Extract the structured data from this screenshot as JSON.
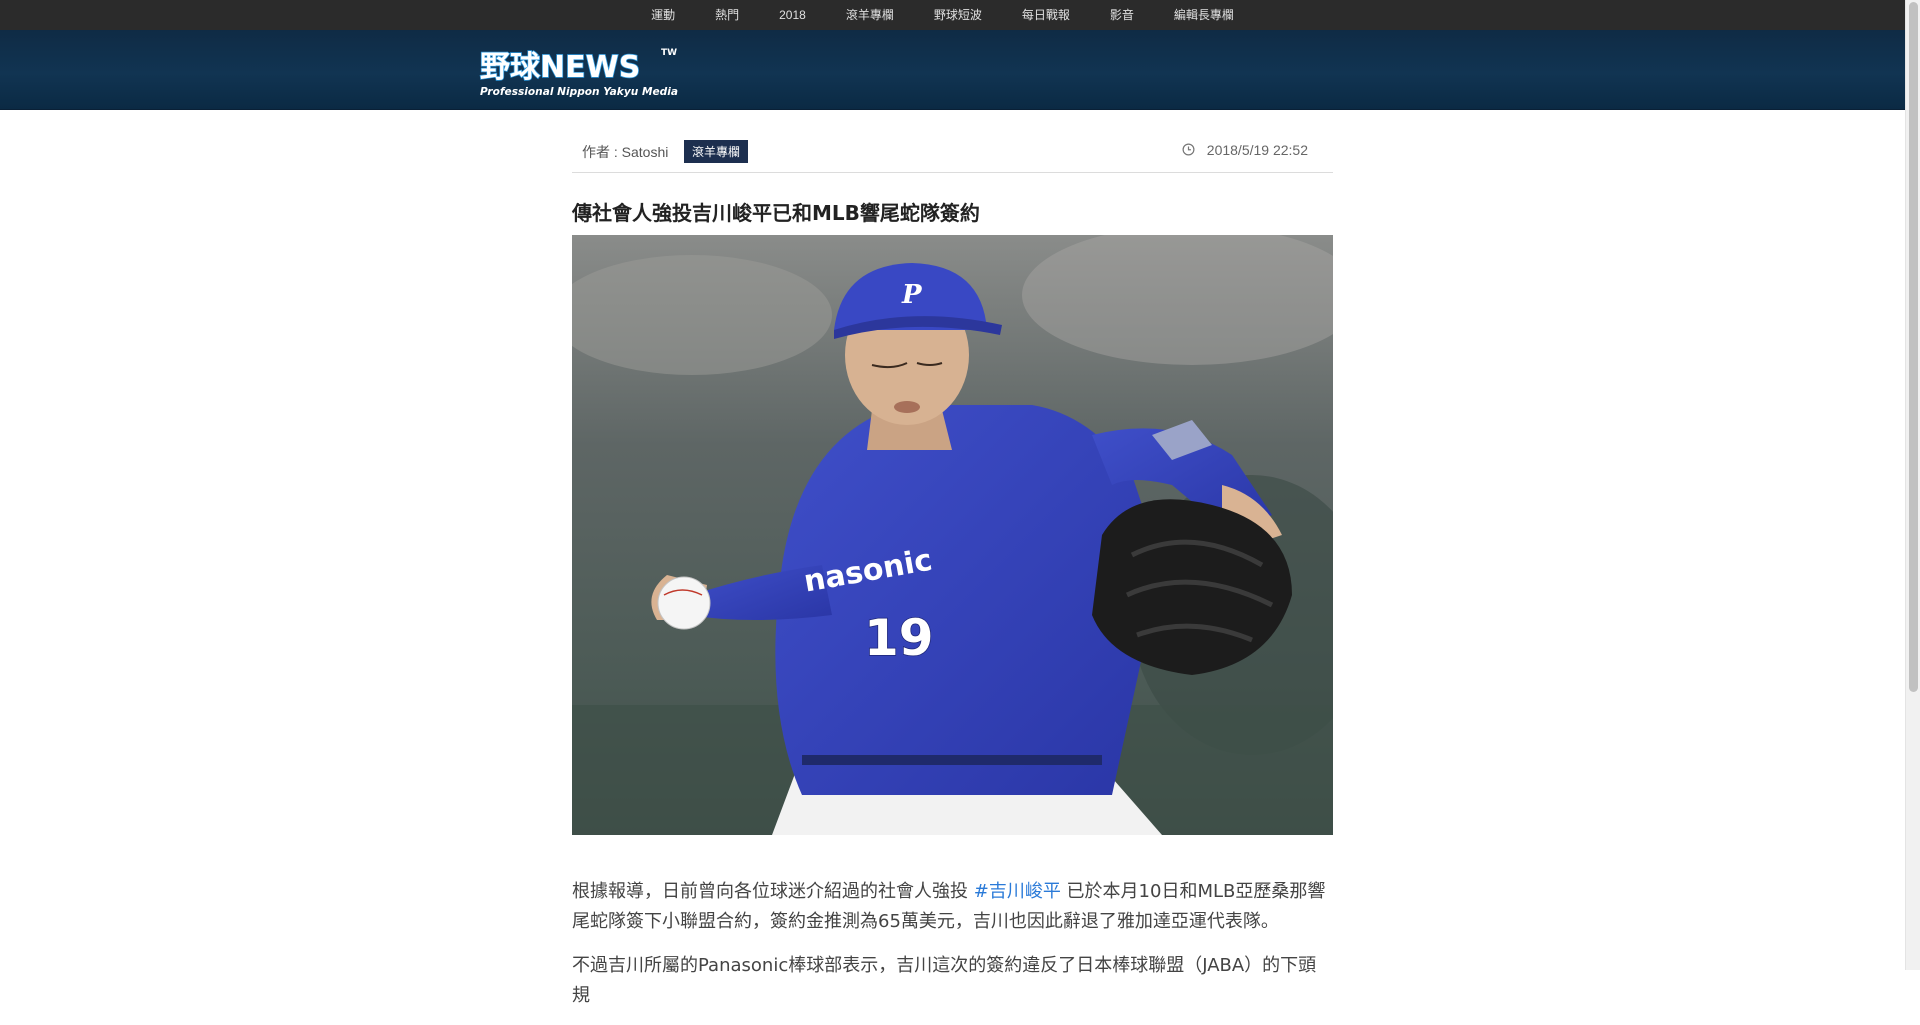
{
  "nav": {
    "items": [
      "運動",
      "熱門",
      "2018",
      "滾羊專欄",
      "野球短波",
      "每日戰報",
      "影音",
      "編輯長專欄"
    ]
  },
  "logo": {
    "main": "野球NEWS",
    "tw": "TW",
    "tagline": "Professional Nippon Yakyu Media"
  },
  "article": {
    "author": "作者 : Satoshi",
    "category": "滾羊專欄",
    "datetime": "2018/5/19 22:52",
    "title": "傳社會人強投吉川峻平已和MLB響尾蛇隊簽約",
    "photo": {
      "cap_logo": "P",
      "jersey_text": "nasonic",
      "jersey_number": "19"
    },
    "paragraph1": {
      "before": "根據報導，日前曾向各位球迷介紹過的社會人強投 ",
      "tag": "#吉川峻平",
      "after": " 已於本月10日和MLB亞歷桑那響尾蛇隊簽下小聯盟合約，簽約金推測為65萬美元，吉川也因此辭退了雅加達亞運代表隊。"
    },
    "paragraph2": "不過吉川所屬的Panasonic棒球部表示，吉川這次的簽約違反了日本棒球聯盟（JABA）的下頭規"
  },
  "colors": {
    "nav_bg": "#2b2b2b",
    "header_bg": "#113452",
    "category_bg": "#1d2f4f",
    "tag_link": "#2a7ad8"
  }
}
